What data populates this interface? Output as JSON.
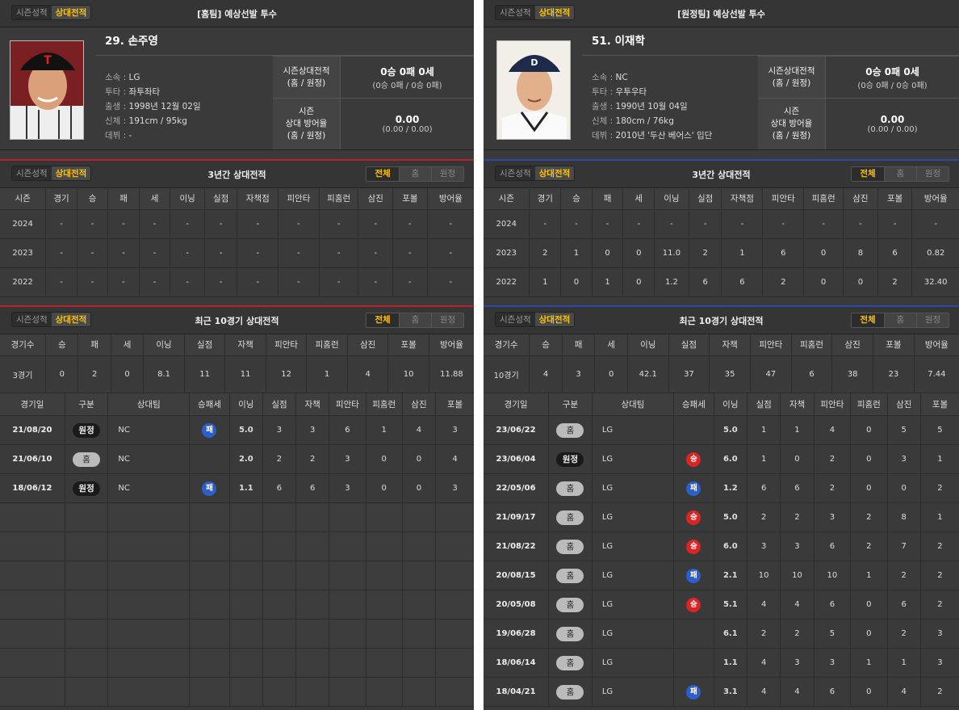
{
  "toggle": {
    "season": "시즌성적",
    "vs": "상대전적"
  },
  "seg": {
    "all": "전체",
    "home": "홈",
    "away": "원정"
  },
  "home": {
    "header_title": "[홈팀] 예상선발 투수",
    "player_name": "29. 손주영",
    "info": [
      {
        "k": "소속",
        "v": "LG"
      },
      {
        "k": "투타",
        "v": "좌투좌타"
      },
      {
        "k": "출생",
        "v": "1998년 12월 02일"
      },
      {
        "k": "신체",
        "v": "191cm / 95kg"
      },
      {
        "k": "데뷔",
        "v": "-"
      }
    ],
    "stat1_label1": "시즌상대전적",
    "stat1_label2": "(홈 / 원정)",
    "stat1_big": "0승 0패 0세",
    "stat1_sm": "(0승 0패 / 0승 0패)",
    "stat2_label1": "시즌",
    "stat2_label2": "상대 방어율",
    "stat2_label3": "(홈 / 원정)",
    "stat2_big": "0.00",
    "stat2_sm": "(0.00 / 0.00)",
    "three_title": "3년간 상대전적",
    "three_cols": [
      "시즌",
      "경기",
      "승",
      "패",
      "세",
      "이닝",
      "실점",
      "자책점",
      "피안타",
      "피홈런",
      "삼진",
      "포볼",
      "방어율"
    ],
    "three_rows": [
      [
        "2024",
        "-",
        "-",
        "-",
        "-",
        "-",
        "-",
        "-",
        "-",
        "-",
        "-",
        "-",
        "-"
      ],
      [
        "2023",
        "-",
        "-",
        "-",
        "-",
        "-",
        "-",
        "-",
        "-",
        "-",
        "-",
        "-",
        "-"
      ],
      [
        "2022",
        "-",
        "-",
        "-",
        "-",
        "-",
        "-",
        "-",
        "-",
        "-",
        "-",
        "-",
        "-"
      ]
    ],
    "recent_title": "최근 10경기 상대전적",
    "summ_cols": [
      "경기수",
      "승",
      "패",
      "세",
      "이닝",
      "실점",
      "자책",
      "피안타",
      "피홈런",
      "삼진",
      "포볼",
      "방어율"
    ],
    "summ": [
      "3경기",
      "0",
      "2",
      "0",
      "8.1",
      "11",
      "11",
      "12",
      "1",
      "4",
      "10",
      "11.88"
    ],
    "game_cols": [
      "경기일",
      "구분",
      "상대팀",
      "승패세",
      "이닝",
      "실점",
      "자책",
      "피안타",
      "피홈런",
      "삼진",
      "포볼"
    ],
    "games": [
      [
        "21/08/20",
        "원정",
        "NC",
        "패",
        "5.0",
        "3",
        "3",
        "6",
        "1",
        "4",
        "3"
      ],
      [
        "21/06/10",
        "홈",
        "NC",
        "",
        "2.0",
        "2",
        "2",
        "3",
        "0",
        "0",
        "4"
      ],
      [
        "18/06/12",
        "원정",
        "NC",
        "패",
        "1.1",
        "6",
        "6",
        "3",
        "0",
        "0",
        "3"
      ]
    ]
  },
  "away": {
    "header_title": "[원정팀] 예상선발 투수",
    "player_name": "51. 이재학",
    "info": [
      {
        "k": "소속",
        "v": "NC"
      },
      {
        "k": "투타",
        "v": "우투우타"
      },
      {
        "k": "출생",
        "v": "1990년 10월 04일"
      },
      {
        "k": "신체",
        "v": "180cm / 76kg"
      },
      {
        "k": "데뷔",
        "v": "2010년 '두산 베어스' 입단"
      }
    ],
    "stat1_label1": "시즌상대전적",
    "stat1_label2": "(홈 / 원정)",
    "stat1_big": "0승 0패 0세",
    "stat1_sm": "(0승 0패 / 0승 0패)",
    "stat2_label1": "시즌",
    "stat2_label2": "상대 방어율",
    "stat2_label3": "(홈 / 원정)",
    "stat2_big": "0.00",
    "stat2_sm": "(0.00 / 0.00)",
    "three_title": "3년간 상대전적",
    "three_cols": [
      "시즌",
      "경기",
      "승",
      "패",
      "세",
      "이닝",
      "실점",
      "자책점",
      "피안타",
      "피홈런",
      "삼진",
      "포볼",
      "방어율"
    ],
    "three_rows": [
      [
        "2024",
        "-",
        "-",
        "-",
        "-",
        "-",
        "-",
        "-",
        "-",
        "-",
        "-",
        "-",
        "-"
      ],
      [
        "2023",
        "2",
        "1",
        "0",
        "0",
        "11.0",
        "2",
        "1",
        "6",
        "0",
        "8",
        "6",
        "0.82"
      ],
      [
        "2022",
        "1",
        "0",
        "1",
        "0",
        "1.2",
        "6",
        "6",
        "2",
        "0",
        "0",
        "2",
        "32.40"
      ]
    ],
    "recent_title": "최근 10경기 상대전적",
    "summ_cols": [
      "경기수",
      "승",
      "패",
      "세",
      "이닝",
      "실점",
      "자책",
      "피안타",
      "피홈런",
      "삼진",
      "포볼",
      "방어율"
    ],
    "summ": [
      "10경기",
      "4",
      "3",
      "0",
      "42.1",
      "37",
      "35",
      "47",
      "6",
      "38",
      "23",
      "7.44"
    ],
    "game_cols": [
      "경기일",
      "구분",
      "상대팀",
      "승패세",
      "이닝",
      "실점",
      "자책",
      "피안타",
      "피홈런",
      "삼진",
      "포볼"
    ],
    "games": [
      [
        "23/06/22",
        "홈",
        "LG",
        "",
        "5.0",
        "1",
        "1",
        "4",
        "0",
        "5",
        "5"
      ],
      [
        "23/06/04",
        "원정",
        "LG",
        "승",
        "6.0",
        "1",
        "0",
        "2",
        "0",
        "3",
        "1"
      ],
      [
        "22/05/06",
        "홈",
        "LG",
        "패",
        "1.2",
        "6",
        "6",
        "2",
        "0",
        "0",
        "2"
      ],
      [
        "21/09/17",
        "홈",
        "LG",
        "승",
        "5.0",
        "2",
        "2",
        "3",
        "2",
        "8",
        "1"
      ],
      [
        "21/08/22",
        "홈",
        "LG",
        "승",
        "6.0",
        "3",
        "3",
        "6",
        "2",
        "7",
        "2"
      ],
      [
        "20/08/15",
        "홈",
        "LG",
        "패",
        "2.1",
        "10",
        "10",
        "10",
        "1",
        "2",
        "2"
      ],
      [
        "20/05/08",
        "홈",
        "LG",
        "승",
        "5.1",
        "4",
        "4",
        "6",
        "0",
        "6",
        "2"
      ],
      [
        "19/06/28",
        "홈",
        "LG",
        "",
        "6.1",
        "2",
        "2",
        "5",
        "0",
        "2",
        "3"
      ],
      [
        "18/06/14",
        "홈",
        "LG",
        "",
        "1.1",
        "4",
        "3",
        "3",
        "1",
        "1",
        "3"
      ],
      [
        "18/04/21",
        "홈",
        "LG",
        "패",
        "3.1",
        "4",
        "4",
        "6",
        "0",
        "4",
        "2"
      ]
    ]
  }
}
